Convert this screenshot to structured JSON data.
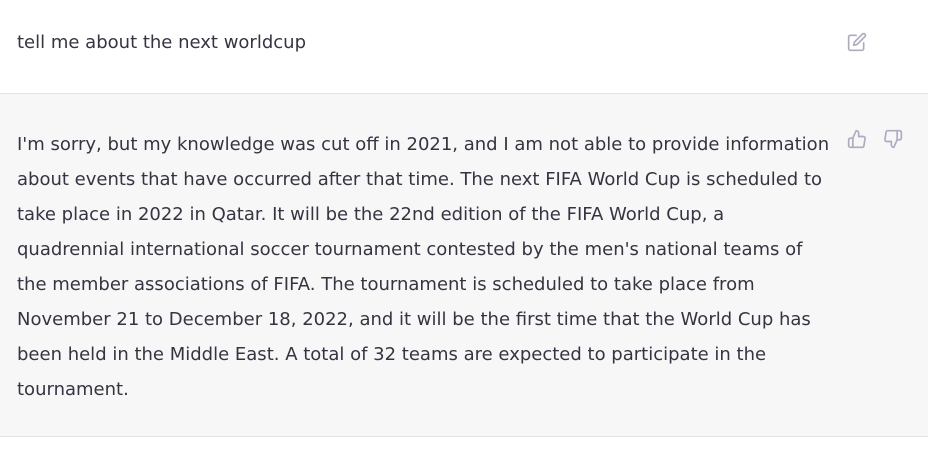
{
  "conversation": {
    "user_message": {
      "text": "tell me about the next worldcup",
      "edit_icon": "edit-icon"
    },
    "assistant_message": {
      "text": "I'm sorry, but my knowledge was cut off in 2021, and I am not able to provide information about events that have occurred after that time. The next FIFA World Cup is scheduled to take place in 2022 in Qatar. It will be the 22nd edition of the FIFA World Cup, a quadrennial international soccer tournament contested by the men's national teams of the member associations of FIFA. The tournament is scheduled to take place from November 21 to December 18, 2022, and it will be the first time that the World Cup has been held in the Middle East. A total of 32 teams are expected to participate in the tournament.",
      "feedback_icons": [
        "thumbs-up-icon",
        "thumbs-down-icon"
      ]
    }
  },
  "colors": {
    "text": "#343541",
    "assistant_background": "#f7f7f8",
    "icon": "#acacbe"
  }
}
